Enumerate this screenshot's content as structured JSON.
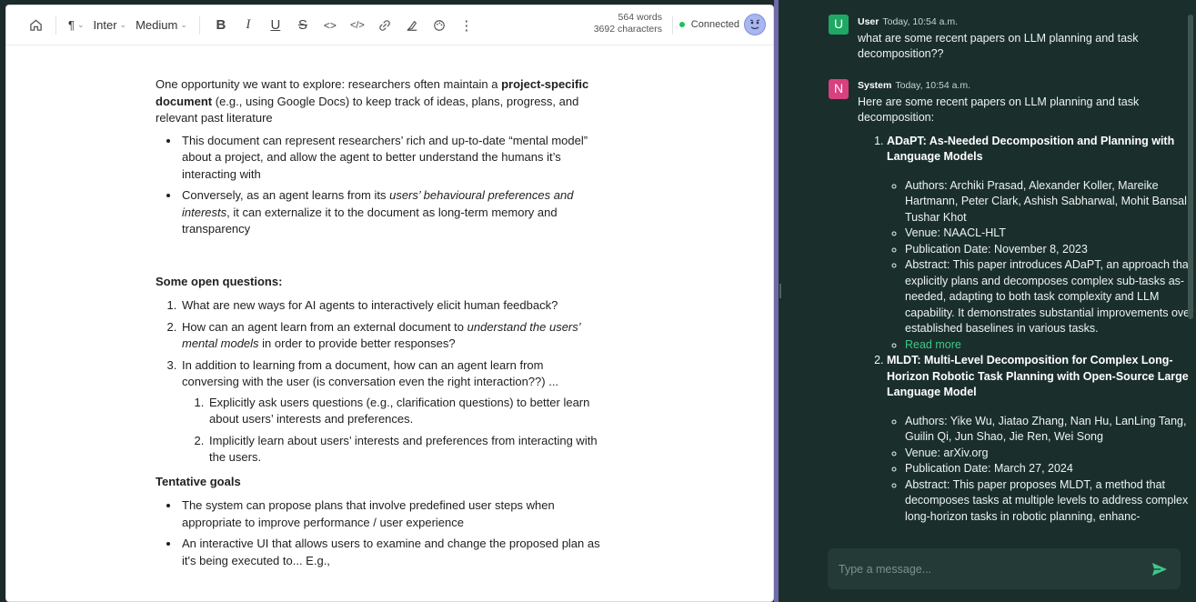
{
  "toolbar": {
    "paragraph_label": "¶",
    "font_label": "Inter",
    "weight_label": "Medium",
    "bold_label": "B",
    "italic_label": "I",
    "underline_label": "U",
    "strike_label": "S",
    "code_label": "<>",
    "codeblock_label": "</>",
    "more_label": "⋮",
    "word_count": "564 words",
    "char_count": "3692 characters",
    "status_label": "Connected",
    "status_color": "#1fbf5f"
  },
  "document": {
    "intro_pre": "One opportunity we want to explore: researchers often maintain a ",
    "intro_bold": "project-specific document",
    "intro_post": " (e.g., using Google Docs) to keep track of ideas, plans, progress, and relevant past literature",
    "bullet1": "This document can represent researchers’ rich and up-to-date “mental model” about a project, and allow the agent to better understand the humans it’s interacting with",
    "bullet2_pre": "Conversely, as an agent learns from its ",
    "bullet2_italic": "users’ behavioural preferences and interests",
    "bullet2_post": ", it can externalize it to the document as long-term memory and transparency",
    "questions_heading": "Some open questions:",
    "q1": "What are new ways for AI agents to interactively elicit human feedback?",
    "q2_pre": "How can an agent learn from an external document to ",
    "q2_italic": "understand the users’ mental models",
    "q2_post": " in order to provide better responses?",
    "q3": "In addition to learning from a document, how can an agent learn from conversing with the user (is conversation even the right interaction??) ...",
    "q3_sub1": "Explicitly ask users questions (e.g., clarification questions) to better learn about users’ interests and preferences.",
    "q3_sub2": "Implicitly learn about users’ interests and preferences from interacting with the users.",
    "goals_heading": "Tentative goals",
    "goal1": "The system can propose plans that involve predefined user steps when appropriate to improve performance / user experience",
    "goal2": "An interactive UI that allows users to examine and change the proposed plan as it's being executed to... E.g.,"
  },
  "chat": {
    "user_msg": {
      "avatar": "U",
      "sender": "User",
      "time": "Today, 10:54 a.m.",
      "text": "what are some recent papers on LLM planning and task decomposition??"
    },
    "system_msg": {
      "avatar": "N",
      "sender": "System",
      "time": "Today, 10:54 a.m.",
      "intro": "Here are some recent papers on LLM planning and task decomposition:"
    },
    "papers": [
      {
        "title": "ADaPT: As-Needed Decomposition and Planning with Language Models",
        "authors": "Authors: Archiki Prasad, Alexander Koller, Mareike Hartmann, Peter Clark, Ashish Sabharwal, Mohit Bansal, Tushar Khot",
        "venue": "Venue: NAACL-HLT",
        "date": "Publication Date: November 8, 2023",
        "abstract": "Abstract: This paper introduces ADaPT, an approach that explicitly plans and decomposes complex sub-tasks as-needed, adapting to both task complexity and LLM capability. It demonstrates substantial improvements over established baselines in various tasks.",
        "read_more": "Read more"
      },
      {
        "title": "MLDT: Multi-Level Decomposition for Complex Long-Horizon Robotic Task Planning with Open-Source Large Language Model",
        "authors": "Authors: Yike Wu, Jiatao Zhang, Nan Hu, LanLing Tang, Guilin Qi, Jun Shao, Jie Ren, Wei Song",
        "venue": "Venue: arXiv.org",
        "date": "Publication Date: March 27, 2024",
        "abstract": "Abstract: This paper proposes MLDT, a method that decomposes tasks at multiple levels to address complex long-horizon tasks in robotic planning, enhanc-"
      }
    ],
    "input_placeholder": "Type a message...",
    "accent_color": "#3ec889"
  }
}
